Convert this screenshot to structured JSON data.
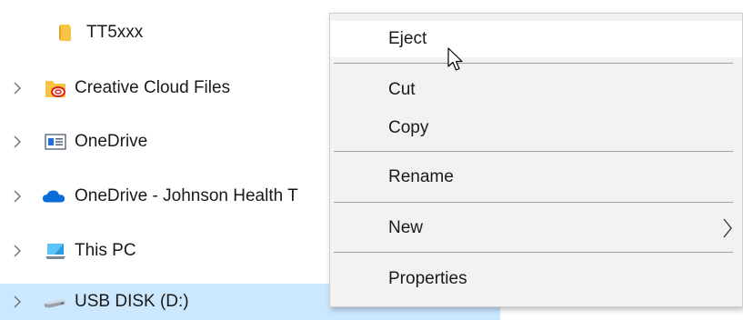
{
  "tree": {
    "items": [
      {
        "label": "TT5xxx",
        "icon": "folder-icon"
      },
      {
        "label": "Creative Cloud Files",
        "icon": "creative-cloud-folder-icon"
      },
      {
        "label": "OneDrive",
        "icon": "onedrive-window-icon"
      },
      {
        "label": "OneDrive - Johnson Health T",
        "icon": "onedrive-cloud-icon"
      },
      {
        "label": "This PC",
        "icon": "this-pc-icon"
      },
      {
        "label": "USB DISK (D:)",
        "icon": "usb-drive-icon",
        "selected": true
      }
    ]
  },
  "context_menu": {
    "items": [
      {
        "label": "Eject",
        "hover": true
      },
      {
        "label": "Cut"
      },
      {
        "label": "Copy"
      },
      {
        "label": "Rename"
      },
      {
        "label": "New",
        "has_submenu": true
      },
      {
        "label": "Properties"
      }
    ]
  },
  "colors": {
    "selection": "#cce8ff",
    "menu_background": "#f2f2f2",
    "menu_hover": "#ffffff",
    "folder": "#f8c442"
  }
}
